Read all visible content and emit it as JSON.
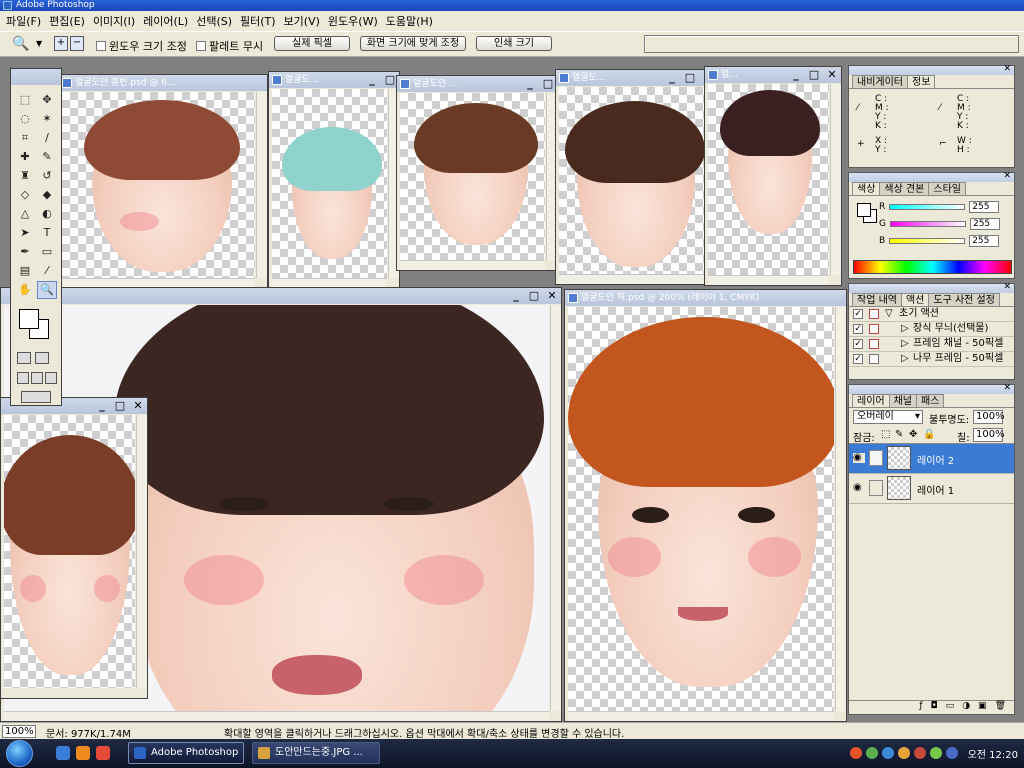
{
  "window": {
    "title": "Adobe Photoshop"
  },
  "menu": [
    "파일(F)",
    "편집(E)",
    "이미지(I)",
    "레이어(L)",
    "선택(S)",
    "필터(T)",
    "보기(V)",
    "윈도우(W)",
    "도움말(H)"
  ],
  "options": {
    "tool_icon": "zoom-tool-icon",
    "resize_windows_label": "윈도우 크기 조정",
    "ignore_palettes_label": "팔레트 무시",
    "actual_pixels_label": "실제 픽셀",
    "fit_on_screen_label": "화면 크기에 맞게 조정",
    "print_size_label": "인쇄 크기"
  },
  "documents": {
    "doc1": {
      "title": "얼굴도안 홍빈.psd @ 6..."
    },
    "doc2": {
      "title": "얼굴도..."
    },
    "doc3": {
      "title": "얼굴도안 ..."
    },
    "doc4": {
      "title": "얼굴도..."
    },
    "doc5": {
      "title": "얼..."
    },
    "doc7": {
      "title": "얼굴도안 혁.psd @ 200% (레이어 1, CMYK)"
    }
  },
  "window_controls": {
    "minimize": "_",
    "maximize": "□",
    "close": "✕"
  },
  "navigator_panel": {
    "tabs": [
      "내비게이터",
      "정보"
    ],
    "cmyk_labels": [
      "C :",
      "M :",
      "Y :",
      "K :"
    ],
    "xy_labels": [
      "X :",
      "Y :"
    ],
    "wh_labels": [
      "W :",
      "H :"
    ]
  },
  "color_panel": {
    "tabs": [
      "색상",
      "색상 견본",
      "스타일"
    ],
    "r_label": "R",
    "g_label": "G",
    "b_label": "B",
    "r_value": "255",
    "g_value": "255",
    "b_value": "255"
  },
  "history_panel": {
    "tabs": [
      "작업 내역",
      "액션",
      "도구 사전 설정"
    ],
    "rows": [
      {
        "label": "초기 액션"
      },
      {
        "label": "장식 무늬(선택물)"
      },
      {
        "label": "프레임 채널 - 50픽셀"
      },
      {
        "label": "나무 프레임 - 50픽셀"
      }
    ]
  },
  "layers_panel": {
    "tabs": [
      "레이어",
      "채널",
      "패스"
    ],
    "blend_mode": "오버레이",
    "opacity_label": "불투명도:",
    "opacity_value": "100%",
    "lock_label": "잠금:",
    "fill_label": "칠:",
    "fill_value": "100%",
    "layers": [
      {
        "name": "레이어 2",
        "selected": true
      },
      {
        "name": "레이어 1",
        "selected": false
      }
    ]
  },
  "status": {
    "zoom": "100%",
    "doc_info": "문서: 977K/1.74M",
    "hint": "확대할 영역을 클릭하거나 드래그하십시오. 옵션 막대에서 확대/축소 상태를 변경할 수 있습니다."
  },
  "taskbar": {
    "tasks": [
      {
        "label": "Adobe Photoshop",
        "active": true
      },
      {
        "label": "도안만드는중.JPG ...",
        "active": false
      }
    ],
    "clock": "오전 12:20"
  },
  "colors": {
    "title_blue": "#1a46b8",
    "selection_blue": "#3a7bd5",
    "chrome": "#ece9d8"
  }
}
